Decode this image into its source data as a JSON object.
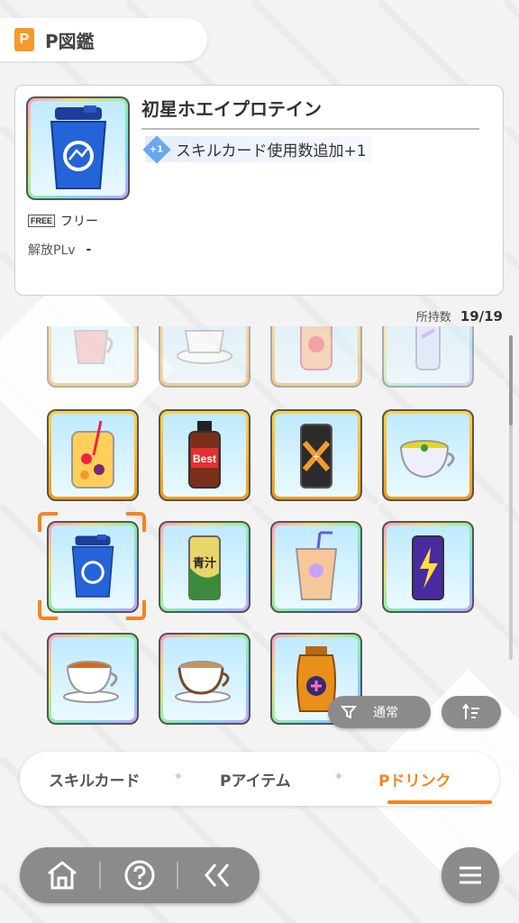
{
  "header": {
    "title": "P図鑑",
    "icon": "p-book-icon"
  },
  "detail": {
    "name": "初星ホエイプロテイン",
    "effect": "スキルカード使用数追加+1",
    "effect_icon_label": "+1",
    "free_badge": "FREE",
    "free_label": "フリー",
    "unlock_label": "解放PLv",
    "unlock_value": "-"
  },
  "owned": {
    "label": "所持数",
    "value": "19/19"
  },
  "grid": {
    "items": [
      {
        "name": "fruit-tea-cup-item",
        "frame": "faded"
      },
      {
        "name": "coffee-cup-item",
        "frame": "faded"
      },
      {
        "name": "strawberry-milk-item",
        "frame": "faded"
      },
      {
        "name": "water-bottle-item",
        "frame": "faded"
      },
      {
        "name": "fruit-juice-jar-item",
        "frame": "gold"
      },
      {
        "name": "energy-drink-bottle-item",
        "frame": "gold",
        "text": "Best"
      },
      {
        "name": "black-can-item",
        "frame": "gold"
      },
      {
        "name": "herbal-tea-cup-item",
        "frame": "gold"
      },
      {
        "name": "whey-protein-shaker-item",
        "frame": "rainbow",
        "selected": true
      },
      {
        "name": "aojiru-can-item",
        "frame": "rainbow",
        "text": "青汁"
      },
      {
        "name": "iced-drink-cup-item",
        "frame": "rainbow"
      },
      {
        "name": "lightning-can-item",
        "frame": "rainbow"
      },
      {
        "name": "tea-cup-item",
        "frame": "rainbow"
      },
      {
        "name": "latte-cup-item",
        "frame": "rainbow"
      },
      {
        "name": "honey-jar-item",
        "frame": "rainbow"
      }
    ]
  },
  "controls": {
    "filter_label": "通常",
    "filter_icon": "filter-icon",
    "sort_icon": "sort-icon"
  },
  "tabs": [
    {
      "label": "スキルカード",
      "active": false
    },
    {
      "label": "Pアイテム",
      "active": false
    },
    {
      "label": "Pドリンク",
      "active": true
    }
  ],
  "nav": {
    "home_icon": "home-icon",
    "help_icon": "help-icon",
    "back_icon": "back-icon",
    "menu_icon": "menu-icon"
  },
  "colors": {
    "accent": "#f5841f",
    "gold_frame": "#ffd24a",
    "nav_bg": "#8b8b8b"
  }
}
